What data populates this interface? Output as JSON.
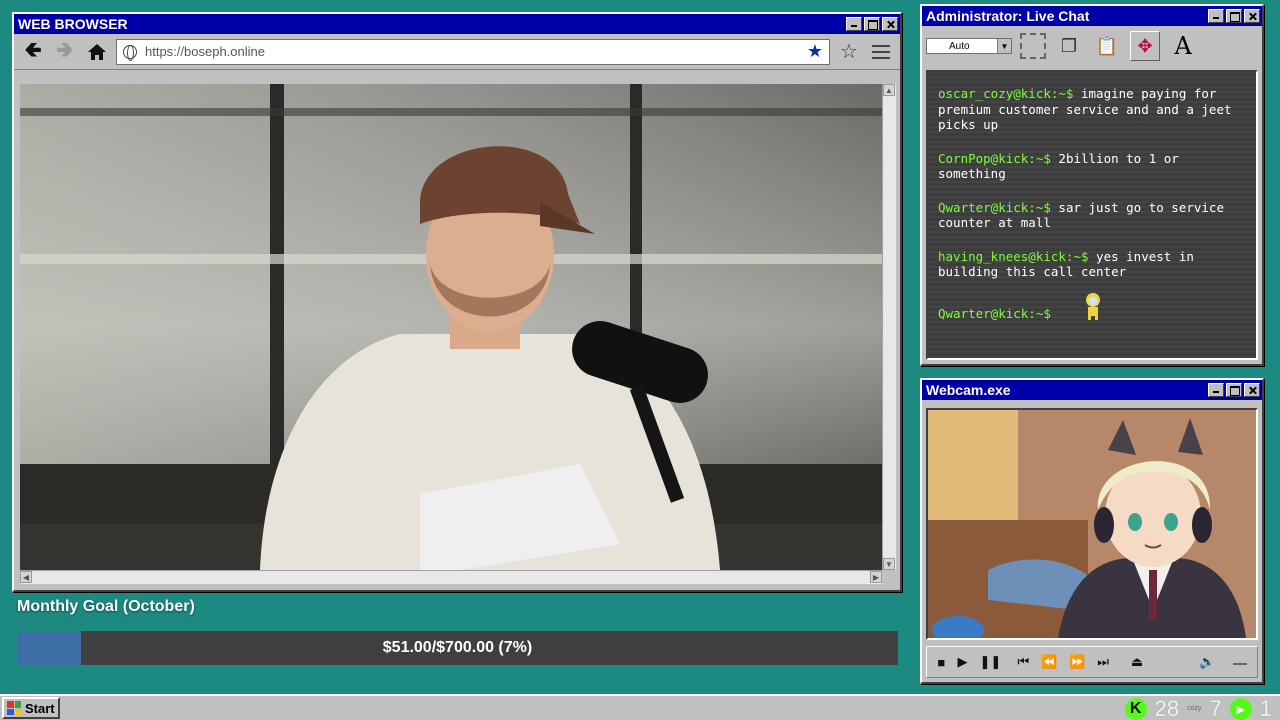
{
  "browser": {
    "title": "WEB BROWSER",
    "url": "https://boseph.online",
    "back_icon": "arrow-left-icon",
    "forward_icon": "arrow-right-icon",
    "home_icon": "home-icon"
  },
  "chat": {
    "title": "Administrator: Live Chat",
    "font_select": "Auto",
    "messages": [
      {
        "user": "oscar_cozy@kick:~$",
        "text": "imagine paying for premium customer service and and a jeet picks up"
      },
      {
        "user": "CornPop@kick:~$",
        "text": "2billion to 1 or something"
      },
      {
        "user": "Qwarter@kick:~$",
        "text": "sar just go to service counter at mall"
      },
      {
        "user": "having_knees@kick:~$",
        "text": "yes invest in building this call center"
      }
    ],
    "prompt": "Qwarter@kick:~$"
  },
  "webcam": {
    "title": "Webcam.exe"
  },
  "goal": {
    "title": "Monthly Goal (October)",
    "text": "$51.00/$700.00 (7%)",
    "progress": 0.073
  },
  "taskbar": {
    "start_label": "Start",
    "kick_letter": "K",
    "viewers": "28",
    "cozy_label": "cozy",
    "count_a": "7",
    "count_b": "1"
  },
  "colors": {
    "desktop": "#1c8a80",
    "titlebar": "#0000a8",
    "chat_user": "#7bff3a",
    "goal_fill": "#3e6ea6",
    "kick_green": "#53fc18"
  }
}
